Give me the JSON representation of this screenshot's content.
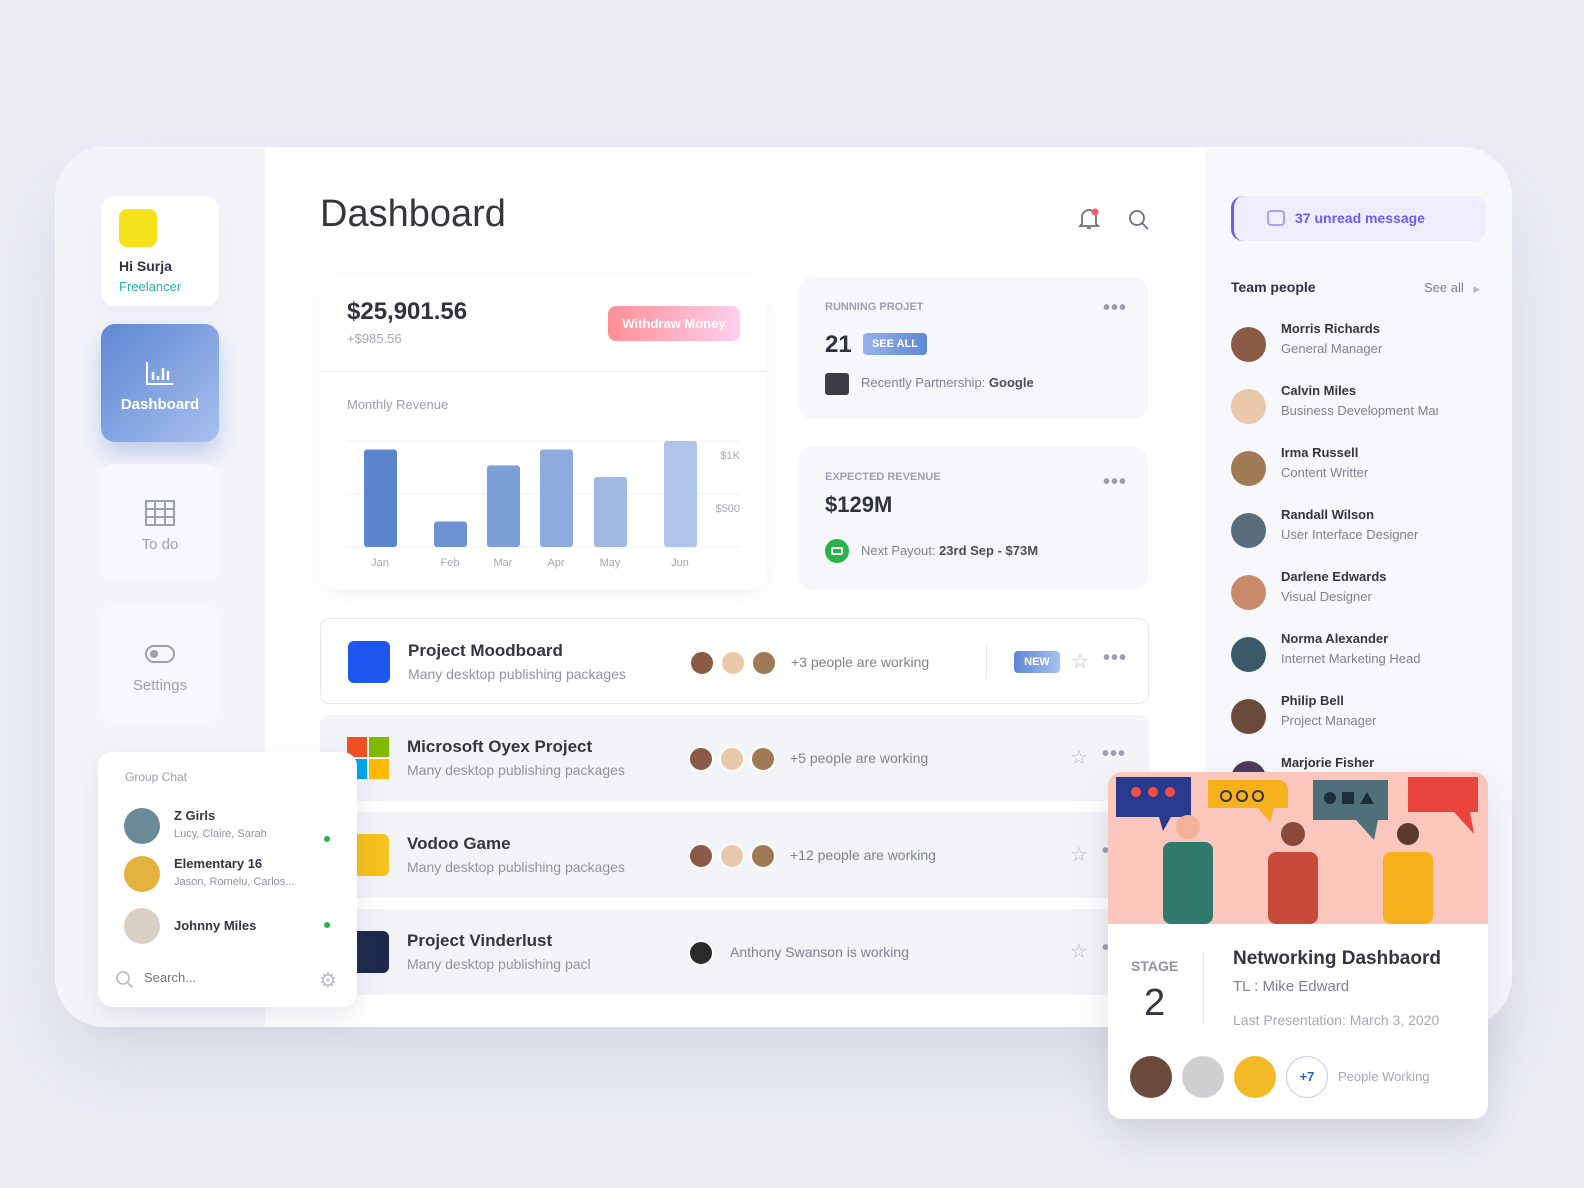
{
  "profile": {
    "greeting": "Hi Surja",
    "role": "Freelancer"
  },
  "nav": [
    {
      "label": "Dashboard",
      "icon": "bar-chart-icon",
      "active": true
    },
    {
      "label": "To do",
      "icon": "grid-icon"
    },
    {
      "label": "Settings",
      "icon": "toggle-icon"
    }
  ],
  "header": {
    "title": "Dashboard"
  },
  "balance": {
    "amount": "$25,901.56",
    "change": "+$985.56",
    "withdraw_label": "Withdraw Money"
  },
  "chart_data": {
    "type": "bar",
    "title": "Monthly Revenue",
    "categories": [
      "Jan",
      "Feb",
      "Mar",
      "Apr",
      "May",
      "Jun"
    ],
    "values": [
      920,
      240,
      770,
      920,
      660,
      1000
    ],
    "ytick_labels": [
      "$500",
      "$1K"
    ],
    "yticks": [
      500,
      1000
    ],
    "ylim": [
      0,
      1000
    ],
    "grid": true,
    "colors": [
      "#5b86cc",
      "#b0c4ea"
    ]
  },
  "running": {
    "label": "RUNNING PROJET",
    "count": "21",
    "see_all": "SEE ALL",
    "partner_prefix": "Recently Partnership: ",
    "partner": "Google"
  },
  "expected": {
    "label": "EXPECTED REVENUE",
    "amount": "$129M",
    "payout_prefix": "Next Payout: ",
    "payout": "23rd Sep - $73M"
  },
  "projects": [
    {
      "title": "Project Moodboard",
      "subtitle": "Many desktop publishing packages",
      "working": "+3 people are working",
      "badge": "NEW",
      "logo": "#1e56f0"
    },
    {
      "title": "Microsoft Oyex Project",
      "subtitle": "Many desktop publishing packages",
      "working": "+5 people are working",
      "logo": "microsoft"
    },
    {
      "title": "Vodoo Game",
      "subtitle": "Many desktop publishing packages",
      "working": "+12 people are working",
      "logo": "#f6c21c"
    },
    {
      "title": "Project Vinderlust",
      "subtitle": "Many desktop publishing pacl",
      "working": "Anthony Swanson is working",
      "logo": "#1d2a4c"
    }
  ],
  "messages": {
    "label": "37 unread message"
  },
  "team": {
    "title": "Team people",
    "see_all": "See all",
    "people": [
      {
        "name": "Morris Richards",
        "role": "General Manager"
      },
      {
        "name": "Calvin Miles",
        "role": "Business Development Manager"
      },
      {
        "name": "Irma Russell",
        "role": "Content Writter"
      },
      {
        "name": "Randall Wilson",
        "role": "User Interface Designer"
      },
      {
        "name": "Darlene Edwards",
        "role": "Visual Designer"
      },
      {
        "name": "Norma Alexander",
        "role": "Internet Marketing Head"
      },
      {
        "name": "Philip Bell",
        "role": "Project Manager"
      },
      {
        "name": "Marjorie Fisher",
        "role": ""
      }
    ]
  },
  "group_chat": {
    "title": "Group Chat",
    "search_placeholder": "Search...",
    "chats": [
      {
        "name": "Z Girls",
        "members": "Lucy, Claire, Sarah",
        "online": true
      },
      {
        "name": "Elementary  16",
        "members": "Jason, Romelu, Carlos...",
        "online": false
      },
      {
        "name": "Johnny Miles",
        "members": "",
        "online": true
      }
    ]
  },
  "networking": {
    "stage_label": "STAGE",
    "stage": "2",
    "title": "Networking Dashbaord",
    "tl": "TL : Mike Edward",
    "last": "Last Presentation: March 3, 2020",
    "more": "+7",
    "people_label": "People Working"
  },
  "colors": {
    "accent": "#6a5cf0",
    "blue": "#5b86cc",
    "pink": "#ff8f94",
    "green": "#29b14a"
  }
}
